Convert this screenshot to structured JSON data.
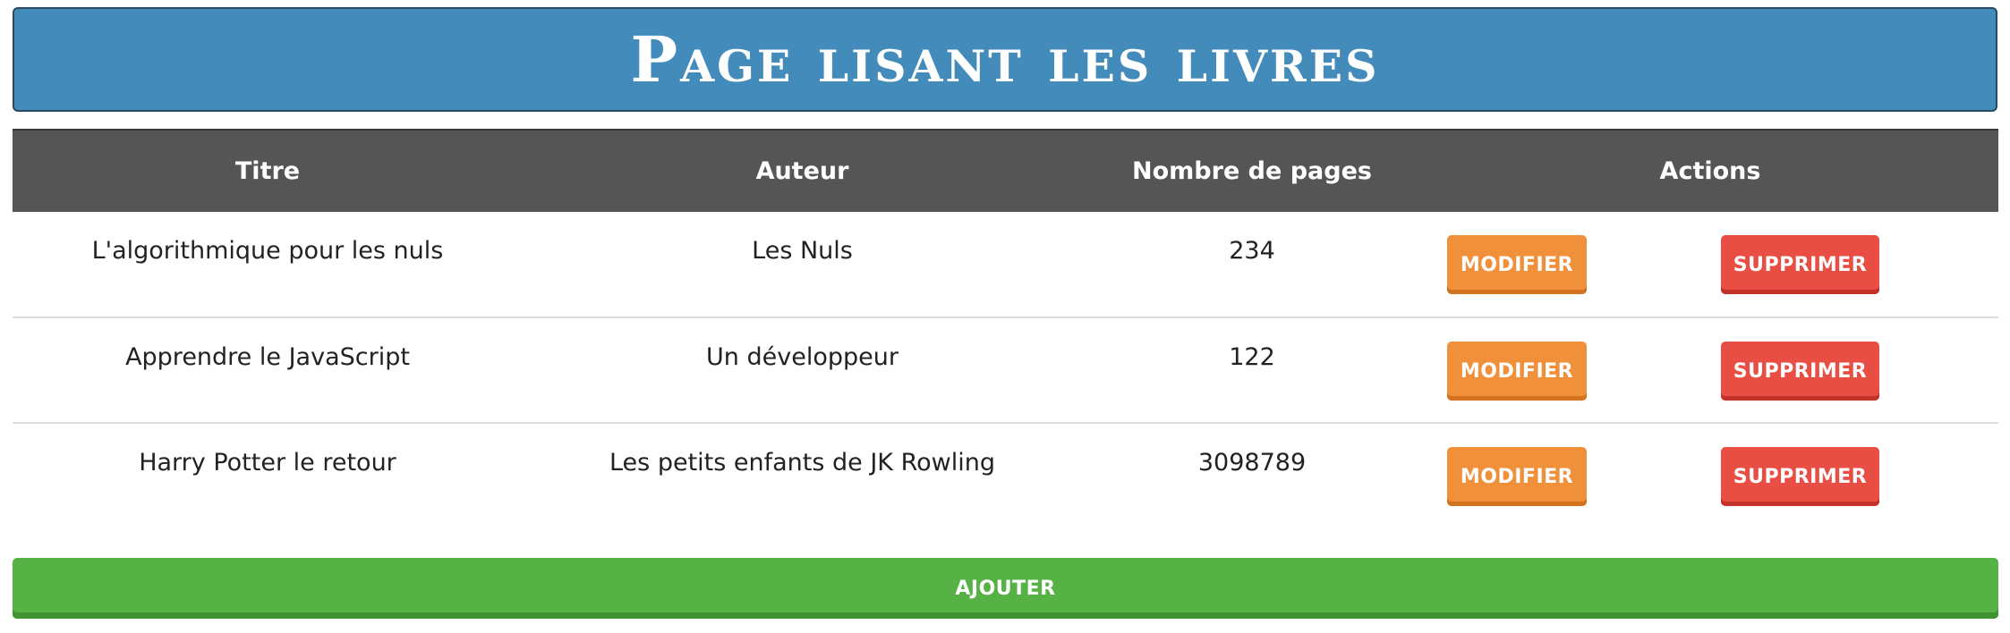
{
  "header": {
    "title": "Page lisant les livres"
  },
  "table": {
    "columns": [
      "Titre",
      "Auteur",
      "Nombre de pages",
      "Actions"
    ],
    "rows": [
      {
        "titre": "L'algorithmique pour les nuls",
        "auteur": "Les Nuls",
        "pages": "234"
      },
      {
        "titre": "Apprendre le JavaScript",
        "auteur": "Un développeur",
        "pages": "122"
      },
      {
        "titre": "Harry Potter le retour",
        "auteur": "Les petits enfants de JK Rowling",
        "pages": "3098789"
      }
    ],
    "modify_label": "MODIFIER",
    "delete_label": "SUPPRIMER"
  },
  "add_label": "AJOUTER",
  "colors": {
    "banner": "#428bba",
    "table_header": "#555555",
    "modify": "#f0903a",
    "delete": "#e84e44",
    "add": "#56b244"
  }
}
